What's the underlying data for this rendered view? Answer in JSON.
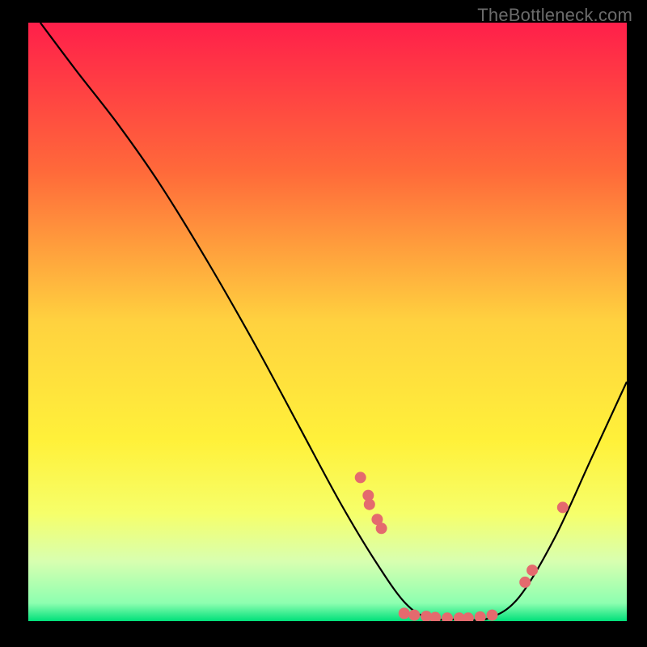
{
  "watermark": "TheBottleneck.com",
  "chart_data": {
    "type": "line",
    "title": "",
    "xlabel": "",
    "ylabel": "",
    "xlim": [
      0,
      100
    ],
    "ylim": [
      0,
      100
    ],
    "gradient": {
      "stops": [
        {
          "offset": 0.0,
          "color": "#ff1f4a"
        },
        {
          "offset": 0.25,
          "color": "#ff6a3a"
        },
        {
          "offset": 0.5,
          "color": "#ffd23f"
        },
        {
          "offset": 0.7,
          "color": "#fff13a"
        },
        {
          "offset": 0.82,
          "color": "#f6ff6a"
        },
        {
          "offset": 0.9,
          "color": "#d8ffb0"
        },
        {
          "offset": 0.97,
          "color": "#8dffb0"
        },
        {
          "offset": 1.0,
          "color": "#00e07a"
        }
      ]
    },
    "curve_points": [
      {
        "x": 2.0,
        "y": 100.0
      },
      {
        "x": 8.0,
        "y": 92.0
      },
      {
        "x": 15.0,
        "y": 83.0
      },
      {
        "x": 22.0,
        "y": 73.0
      },
      {
        "x": 30.0,
        "y": 60.0
      },
      {
        "x": 38.0,
        "y": 46.0
      },
      {
        "x": 45.0,
        "y": 33.0
      },
      {
        "x": 52.0,
        "y": 20.0
      },
      {
        "x": 58.0,
        "y": 10.0
      },
      {
        "x": 63.0,
        "y": 3.0
      },
      {
        "x": 67.0,
        "y": 0.5
      },
      {
        "x": 72.0,
        "y": 0.3
      },
      {
        "x": 77.0,
        "y": 0.5
      },
      {
        "x": 82.0,
        "y": 4.0
      },
      {
        "x": 88.0,
        "y": 14.0
      },
      {
        "x": 94.0,
        "y": 27.0
      },
      {
        "x": 100.0,
        "y": 40.0
      }
    ],
    "scatter_points": [
      {
        "x": 55.5,
        "y": 24.0
      },
      {
        "x": 56.8,
        "y": 21.0
      },
      {
        "x": 57.0,
        "y": 19.5
      },
      {
        "x": 58.3,
        "y": 17.0
      },
      {
        "x": 59.0,
        "y": 15.5
      },
      {
        "x": 62.8,
        "y": 1.3
      },
      {
        "x": 64.5,
        "y": 1.0
      },
      {
        "x": 66.5,
        "y": 0.8
      },
      {
        "x": 68.0,
        "y": 0.6
      },
      {
        "x": 70.0,
        "y": 0.5
      },
      {
        "x": 72.0,
        "y": 0.5
      },
      {
        "x": 73.5,
        "y": 0.5
      },
      {
        "x": 75.5,
        "y": 0.7
      },
      {
        "x": 77.5,
        "y": 1.0
      },
      {
        "x": 83.0,
        "y": 6.5
      },
      {
        "x": 84.2,
        "y": 8.5
      },
      {
        "x": 89.3,
        "y": 19.0
      }
    ],
    "scatter_color": "#e46a6e",
    "curve_color": "#000000"
  }
}
